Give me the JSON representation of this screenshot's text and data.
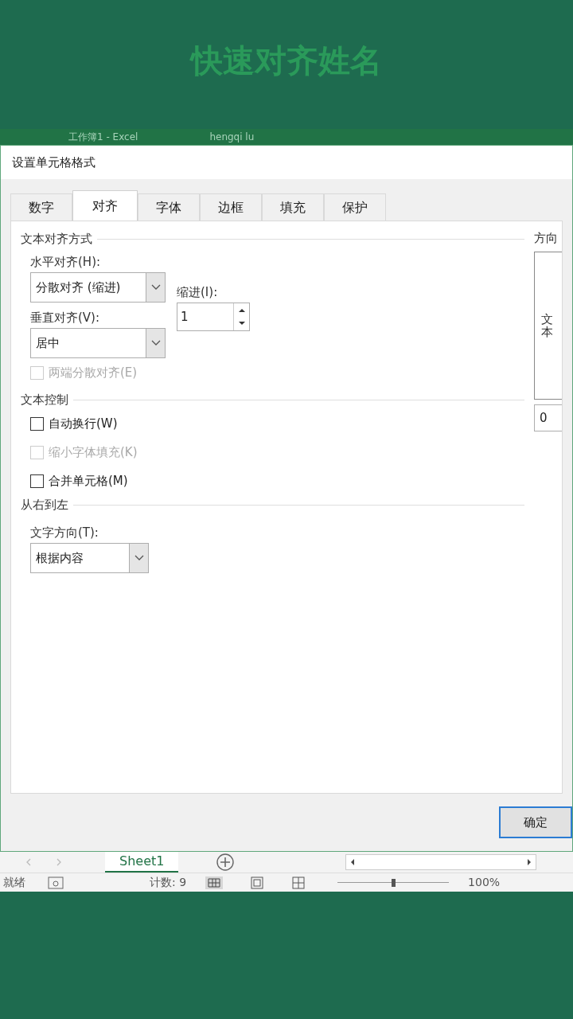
{
  "caption": "快速对齐姓名",
  "app_titlebar": {
    "title": "工作簿1 - Excel",
    "user": "hengqi lu"
  },
  "dialog": {
    "title": "设置单元格格式",
    "tabs": [
      {
        "label": "数字",
        "selected": false
      },
      {
        "label": "对齐",
        "selected": true
      },
      {
        "label": "字体",
        "selected": false
      },
      {
        "label": "边框",
        "selected": false
      },
      {
        "label": "填充",
        "selected": false
      },
      {
        "label": "保护",
        "selected": false
      }
    ],
    "text_alignment": {
      "heading": "文本对齐方式",
      "horizontal_label": "水平对齐(H):",
      "horizontal_value": "分散对齐 (缩进)",
      "indent_label": "缩进(I):",
      "indent_value": "1",
      "vertical_label": "垂直对齐(V):",
      "vertical_value": "居中",
      "justify_distributed": {
        "label": "两端分散对齐(E)",
        "checked": false,
        "disabled": true
      }
    },
    "text_control": {
      "heading": "文本控制",
      "options": [
        {
          "label": "自动换行(W)",
          "checked": false,
          "disabled": false
        },
        {
          "label": "缩小字体填充(K)",
          "checked": false,
          "disabled": true
        },
        {
          "label": "合并单元格(M)",
          "checked": false,
          "disabled": false
        }
      ]
    },
    "rtl": {
      "heading": "从右到左",
      "direction_label": "文字方向(T):",
      "direction_value": "根据内容"
    },
    "orientation": {
      "heading": "方向",
      "vertical_text": "文本",
      "degrees": "0"
    },
    "ok_button": "确定"
  },
  "sheet_tabs": [
    {
      "label": "Sheet1",
      "selected": true
    }
  ],
  "status_bar": {
    "state": "就绪",
    "count": "计数: 9",
    "zoom": "100%",
    "zoom_slider": {
      "level": 0.5
    }
  }
}
